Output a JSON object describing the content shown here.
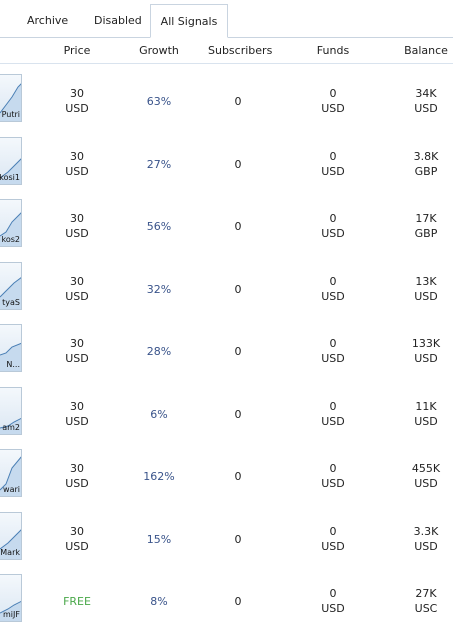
{
  "tabs": [
    {
      "label": "Archive"
    },
    {
      "label": "Disabled"
    },
    {
      "label": "All Signals"
    }
  ],
  "columns": {
    "price": "Price",
    "growth": "Growth",
    "subscribers": "Subscribers",
    "funds": "Funds",
    "balance": "Balance"
  },
  "rows": [
    {
      "name_fragment": "Putri",
      "price": "30",
      "price_currency": "USD",
      "growth": "63%",
      "subscribers": "0",
      "funds": "0",
      "funds_currency": "USD",
      "balance": "34K",
      "balance_currency": "USD"
    },
    {
      "name_fragment": "kosi1",
      "price": "30",
      "price_currency": "USD",
      "growth": "27%",
      "subscribers": "0",
      "funds": "0",
      "funds_currency": "USD",
      "balance": "3.8K",
      "balance_currency": "GBP"
    },
    {
      "name_fragment": "kos2",
      "price": "30",
      "price_currency": "USD",
      "growth": "56%",
      "subscribers": "0",
      "funds": "0",
      "funds_currency": "USD",
      "balance": "17K",
      "balance_currency": "GBP"
    },
    {
      "name_fragment": "tyaS",
      "price": "30",
      "price_currency": "USD",
      "growth": "32%",
      "subscribers": "0",
      "funds": "0",
      "funds_currency": "USD",
      "balance": "13K",
      "balance_currency": "USD"
    },
    {
      "name_fragment": "N...",
      "price": "30",
      "price_currency": "USD",
      "growth": "28%",
      "subscribers": "0",
      "funds": "0",
      "funds_currency": "USD",
      "balance": "133K",
      "balance_currency": "USD"
    },
    {
      "name_fragment": "am2",
      "price": "30",
      "price_currency": "USD",
      "growth": "6%",
      "subscribers": "0",
      "funds": "0",
      "funds_currency": "USD",
      "balance": "11K",
      "balance_currency": "USD"
    },
    {
      "name_fragment": "wari",
      "price": "30",
      "price_currency": "USD",
      "growth": "162%",
      "subscribers": "0",
      "funds": "0",
      "funds_currency": "USD",
      "balance": "455K",
      "balance_currency": "USD"
    },
    {
      "name_fragment": "Mark",
      "price": "30",
      "price_currency": "USD",
      "growth": "15%",
      "subscribers": "0",
      "funds": "0",
      "funds_currency": "USD",
      "balance": "3.3K",
      "balance_currency": "USD"
    },
    {
      "name_fragment": "miJF",
      "price": "FREE",
      "price_currency": "",
      "growth": "8%",
      "subscribers": "0",
      "funds": "0",
      "funds_currency": "USD",
      "balance": "27K",
      "balance_currency": "USC"
    }
  ],
  "colors": {
    "growth_text": "#39538a",
    "free_text": "#4aa84a",
    "border": "#c9d4e0"
  }
}
